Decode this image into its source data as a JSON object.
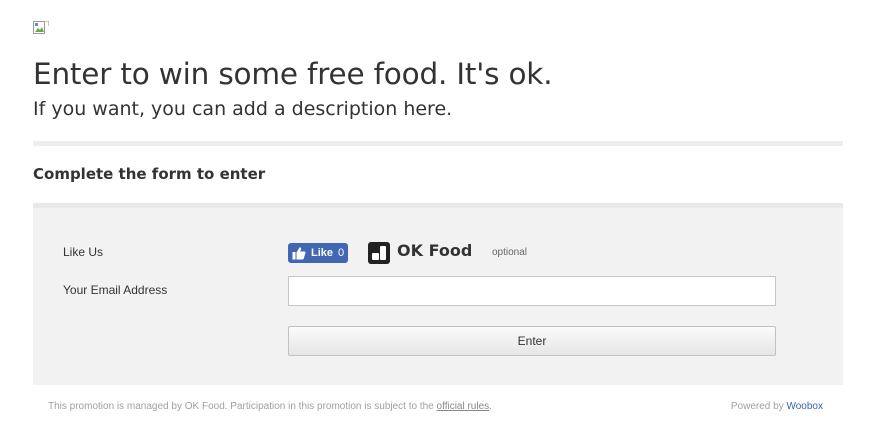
{
  "header": {
    "title": "Enter to win some free food. It's ok.",
    "subtitle": "If you want, you can add a description here."
  },
  "form": {
    "section_title": "Complete the form to enter",
    "like_label": "Like Us",
    "like_button_label": "Like",
    "like_count": "0",
    "page_name": "OK Food",
    "optional_label": "optional",
    "email_label": "Your Email Address",
    "email_value": "",
    "email_placeholder": "",
    "submit_label": "Enter"
  },
  "footer": {
    "disclaimer_prefix": "This promotion is managed by OK Food. Participation in this promotion is subject to the",
    "rules_link": "official rules",
    "disclaimer_suffix": ".",
    "powered_by": "Powered by",
    "brand_link": "Woobox"
  },
  "colors": {
    "facebook_blue": "#4267b2",
    "panel_bg": "#f2f2f2",
    "link_blue": "#3366aa"
  },
  "icons": [
    "broken-image-icon",
    "thumbs-up-icon",
    "page-logo-icon"
  ]
}
